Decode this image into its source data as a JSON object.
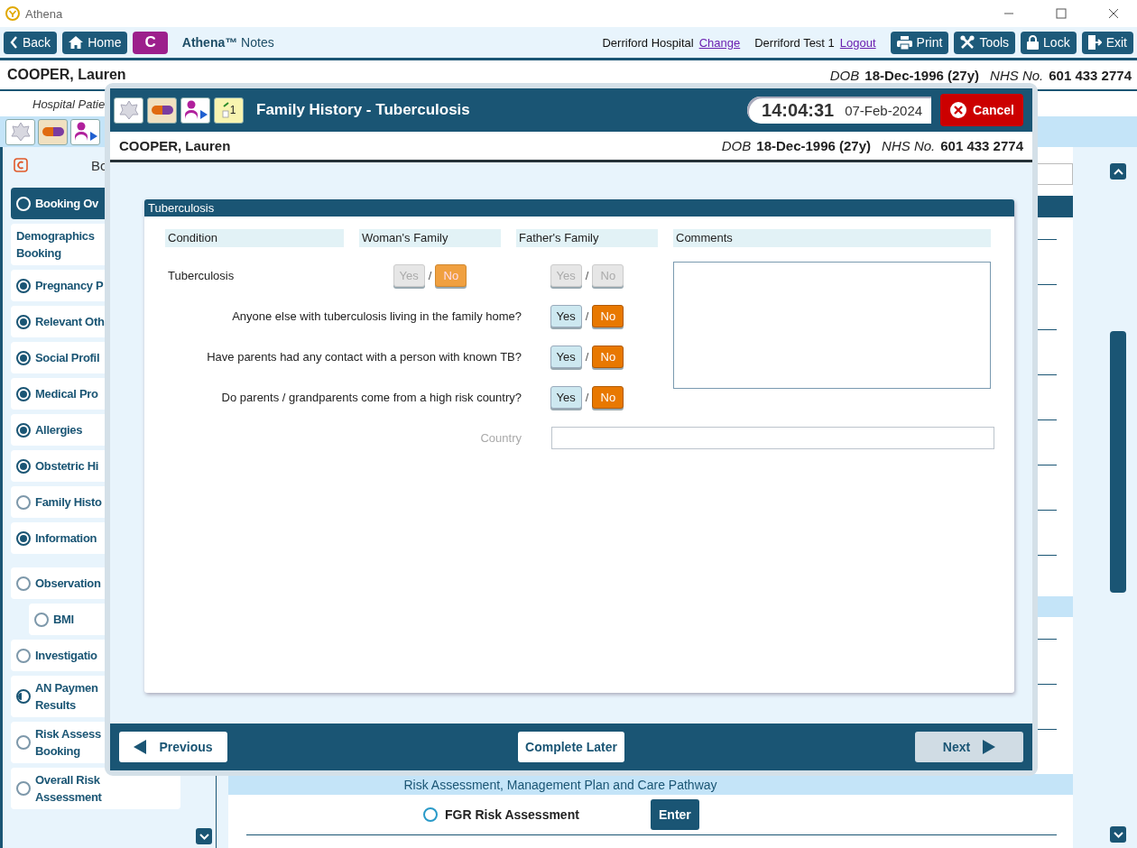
{
  "app": {
    "title": "Athena"
  },
  "toolbar": {
    "left_buttons": [
      {
        "kind": "back",
        "label": "Back"
      },
      {
        "kind": "home",
        "label": "Home"
      },
      {
        "kind": "c",
        "label": "C"
      }
    ],
    "app_name": "**Athena™** Notes",
    "location": "Derriford Hospital",
    "location_link": "Change",
    "user": "Derriford Test 1",
    "user_link": "Logout",
    "right_buttons": [
      {
        "kind": "print",
        "label": "Print"
      },
      {
        "kind": "tools",
        "label": "Tools"
      },
      {
        "kind": "lock",
        "label": "Lock"
      },
      {
        "kind": "exit",
        "label": "Exit"
      }
    ]
  },
  "patient": {
    "name": "COOPER, Lauren",
    "dob_label": "DOB",
    "dob": "18-Dec-1996 (27y)",
    "nhs_label": "NHS No.",
    "nhs": "601 433 2774"
  },
  "subheader": "Hospital Patie",
  "icon_bar": {
    "icons": [
      {
        "kind": "star"
      },
      {
        "kind": "pill"
      },
      {
        "kind": "person"
      }
    ]
  },
  "sidebar": {
    "title": "Bo",
    "items": [
      {
        "lines": [
          "Booking Ov"
        ],
        "selected": true,
        "kind": "empty"
      },
      {
        "lines": [
          "Demographics",
          "Booking"
        ],
        "selected": false,
        "kind": "plain"
      },
      {
        "lines": [
          "Pregnancy P"
        ],
        "selected": false,
        "kind": "complete"
      },
      {
        "lines": [
          "Relevant Oth"
        ],
        "selected": false,
        "kind": "complete"
      },
      {
        "lines": [
          "Social Profil"
        ],
        "selected": false,
        "kind": "complete"
      },
      {
        "lines": [
          "Medical Pro"
        ],
        "selected": false,
        "kind": "complete"
      },
      {
        "lines": [
          "Allergies"
        ],
        "selected": false,
        "kind": "complete"
      },
      {
        "lines": [
          "Obstetric Hi"
        ],
        "selected": false,
        "kind": "complete"
      },
      {
        "lines": [
          "Family Histo"
        ],
        "selected": false,
        "kind": "empty"
      },
      {
        "lines": [
          "Information"
        ],
        "selected": false,
        "kind": "complete"
      },
      {
        "lines": [
          "Observation"
        ],
        "selected": false,
        "kind": "empty",
        "children": [
          {
            "lines": [
              "BMI"
            ],
            "selected": false,
            "kind": "empty"
          }
        ]
      },
      {
        "lines": [
          "Investigatio"
        ],
        "selected": false,
        "kind": "empty"
      },
      {
        "lines": [
          "AN Paymen",
          "Results"
        ],
        "selected": false,
        "kind": "partial"
      },
      {
        "lines": [
          "Risk Assess",
          "Booking"
        ],
        "selected": false,
        "kind": "empty"
      },
      {
        "lines": [
          "Overall Risk",
          "Assessment"
        ],
        "selected": false,
        "kind": "empty"
      }
    ]
  },
  "main": {
    "section_title": "Risk Assessment, Management Plan and Care Pathway",
    "items": [
      {
        "label": "FGR Risk Assessment",
        "kind": "empty",
        "action": "Enter"
      }
    ]
  },
  "modal": {
    "icons": [
      {
        "kind": "star"
      },
      {
        "kind": "pill"
      },
      {
        "kind": "person"
      },
      {
        "kind": "calendar",
        "label": "1"
      }
    ],
    "title": "Family History - Tuberculosis",
    "time": "14:04:31",
    "date": "07-Feb-2024",
    "cancel": "Cancel",
    "patient": {
      "name": "COOPER, Lauren",
      "dob_label": "DOB",
      "dob": "18-Dec-1996 (27y)",
      "nhs_label": "NHS No.",
      "nhs": "601 433 2774"
    },
    "section": {
      "title": "Tuberculosis",
      "columns": [
        "Condition",
        "Woman's Family",
        "Father's Family",
        "Comments"
      ],
      "condition": {
        "label": "Tuberculosis",
        "disabled": true,
        "woman": {
          "separator": "/",
          "options": [
            {
              "label": "Yes",
              "selected": false
            },
            {
              "label": "No",
              "selected": true
            }
          ]
        },
        "father": {
          "separator": "/",
          "options": [
            {
              "label": "Yes",
              "selected": false
            },
            {
              "label": "No",
              "selected": false
            }
          ]
        }
      },
      "questions": [
        {
          "label": "Anyone else with tuberculosis living in the family home?",
          "separator": "/",
          "options": [
            {
              "label": "Yes",
              "selected": false
            },
            {
              "label": "No",
              "selected": true
            }
          ]
        },
        {
          "label": "Have parents had any contact with a person with known TB?",
          "separator": "/",
          "options": [
            {
              "label": "Yes",
              "selected": false
            },
            {
              "label": "No",
              "selected": true
            }
          ]
        },
        {
          "label": "Do parents / grandparents come from a high risk country?",
          "separator": "/",
          "options": [
            {
              "label": "Yes",
              "selected": false
            },
            {
              "label": "No",
              "selected": true
            }
          ]
        }
      ],
      "country": {
        "label": "Country",
        "disabled": true
      }
    },
    "footer": [
      {
        "kind": "previous",
        "label": "Previous",
        "disabled": false
      },
      {
        "kind": "later",
        "label": "Complete Later",
        "disabled": false
      },
      {
        "kind": "next",
        "label": "Next",
        "disabled": true
      }
    ]
  }
}
